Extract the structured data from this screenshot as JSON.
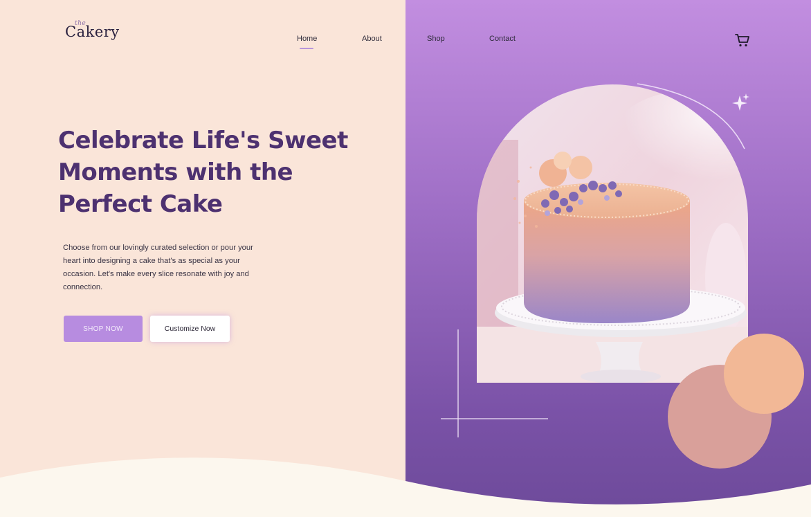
{
  "brand": {
    "name": "Cakery",
    "tag": "the"
  },
  "nav": {
    "items": [
      {
        "label": "Home",
        "active": true
      },
      {
        "label": "About"
      },
      {
        "label": "Shop"
      },
      {
        "label": "Contact"
      }
    ],
    "cart_icon": "shopping-cart-icon"
  },
  "hero": {
    "headline": "Celebrate Life's Sweet Moments with the Perfect Cake",
    "description": "Choose from our lovingly curated selection or pour your heart into designing a cake that's as special as your occasion. Let's make every slice resonate with joy and connection.",
    "primary_button": "SHOP NOW",
    "secondary_button": "Customize Now"
  },
  "colors": {
    "accent": "#b78ce0",
    "headline": "#4d3170",
    "left_bg": "#fae5d9",
    "right_bg": "#9f6fc6",
    "circle_peach": "#f2b896",
    "circle_rose": "#d9a09a"
  }
}
